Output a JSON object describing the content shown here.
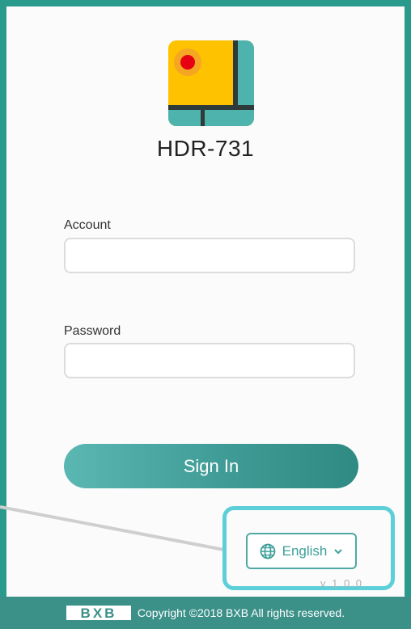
{
  "app": {
    "title": "HDR-731"
  },
  "form": {
    "account_label": "Account",
    "account_value": "",
    "password_label": "Password",
    "password_value": "",
    "signin_label": "Sign In"
  },
  "language": {
    "selected": "English",
    "icon": "globe-icon"
  },
  "version": "v 1.0.0",
  "footer": {
    "brand": "BXB",
    "copyright": "Copyright ©2018 BXB All rights reserved."
  },
  "colors": {
    "background": "#2a9a8c",
    "accent": "#3d9f99",
    "highlight": "#5ccfd9",
    "logo_yellow": "#ffc200",
    "logo_teal": "#4fb3ad",
    "logo_dot": "#e60012"
  }
}
